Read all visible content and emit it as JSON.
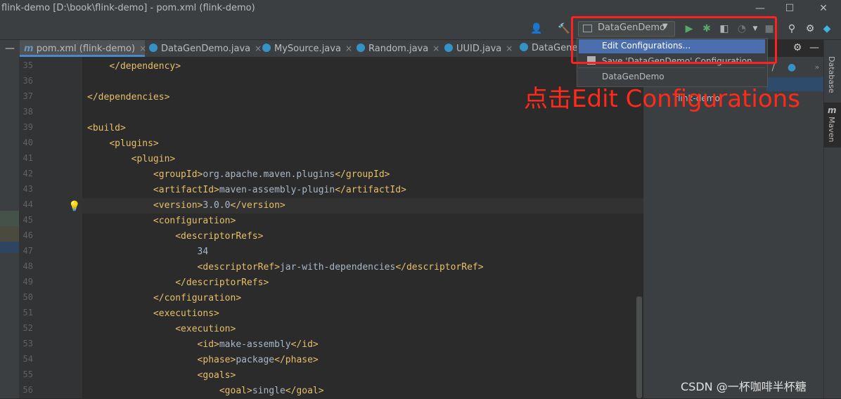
{
  "window": {
    "title": "flink-demo [D:\\book\\flink-demo] - pom.xml (flink-demo)",
    "minimize": "—",
    "maximize": "☐",
    "close": "✕"
  },
  "toolbar": {
    "run_config": "DataGenDemo"
  },
  "tabs": [
    {
      "label": "pom.xml (flink-demo)",
      "prefix": "m",
      "close": "×"
    },
    {
      "label": "DataGenDemo.java",
      "close": "×"
    },
    {
      "label": "MySource.java",
      "close": "×"
    },
    {
      "label": "Random.java",
      "close": "×"
    },
    {
      "label": "UUID.java",
      "close": "×"
    },
    {
      "label": "DataGenera"
    }
  ],
  "menu": {
    "items": [
      {
        "label": "Edit Configurations..."
      },
      {
        "label": "Save 'DataGenDemo' Configuration"
      },
      {
        "label": "DataGenDemo"
      }
    ]
  },
  "right_panel": {
    "tree_item": "flink-demo",
    "strip_labels": [
      "Database",
      "Maven"
    ]
  },
  "editor": {
    "lines": [
      {
        "n": "35",
        "code": "        </dependency>"
      },
      {
        "n": "36",
        "code": ""
      },
      {
        "n": "37",
        "code": "    </dependencies>"
      },
      {
        "n": "38",
        "code": ""
      },
      {
        "n": "39",
        "code": "    <build>"
      },
      {
        "n": "40",
        "code": "        <plugins>"
      },
      {
        "n": "41",
        "code": "            <plugin>"
      },
      {
        "n": "42",
        "code": "                <groupId>org.apache.maven.plugins</groupId>"
      },
      {
        "n": "43",
        "code": "                <artifactId>maven-assembly-plugin</artifactId>"
      },
      {
        "n": "44",
        "code": "                <version>3.0.0</version>"
      },
      {
        "n": "45",
        "code": "                <configuration>"
      },
      {
        "n": "46",
        "code": "                    <descriptorRefs>"
      },
      {
        "n": "47",
        "code": "                        34"
      },
      {
        "n": "48",
        "code": "                        <descriptorRef>jar-with-dependencies</descriptorRef>"
      },
      {
        "n": "49",
        "code": "                    </descriptorRefs>"
      },
      {
        "n": "50",
        "code": "                </configuration>"
      },
      {
        "n": "51",
        "code": "                <executions>"
      },
      {
        "n": "52",
        "code": "                    <execution>"
      },
      {
        "n": "53",
        "code": "                        <id>make-assembly</id>"
      },
      {
        "n": "54",
        "code": "                        <phase>package</phase>"
      },
      {
        "n": "55",
        "code": "                        <goals>"
      },
      {
        "n": "56",
        "code": "                            <goal>single</goal>"
      }
    ]
  },
  "annotation": "点击Edit Configurations",
  "watermark": "CSDN @一杯咖啡半杯糖",
  "colors": {
    "accent": "#4b6eaf",
    "annotation": "#ff2a1a",
    "tag": "#e8bf6a"
  }
}
